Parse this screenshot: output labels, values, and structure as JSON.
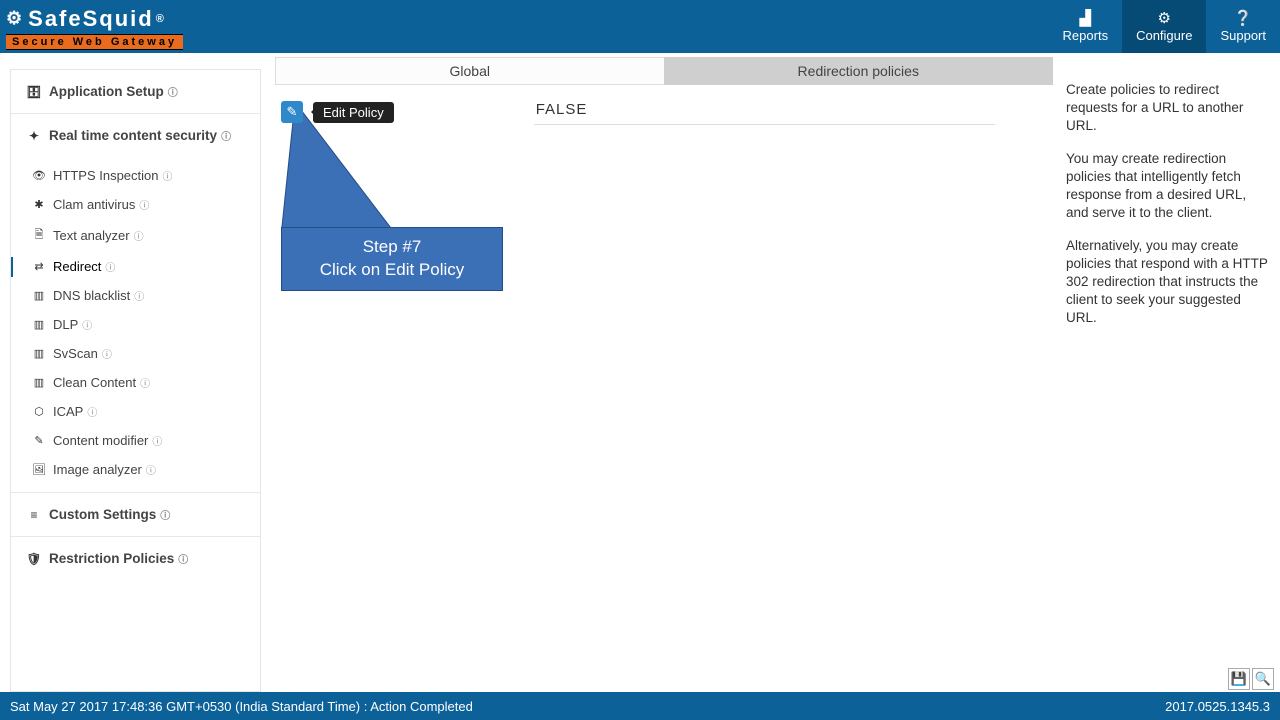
{
  "brand": {
    "name": "SafeSquid",
    "reg": "®",
    "tagline": "Secure Web Gateway"
  },
  "nav": {
    "reports": "Reports",
    "configure": "Configure",
    "support": "Support"
  },
  "sidebar": {
    "app_setup": "Application Setup",
    "realtime": "Real time content security",
    "items": [
      {
        "label": "HTTPS Inspection"
      },
      {
        "label": "Clam antivirus"
      },
      {
        "label": "Text analyzer"
      },
      {
        "label": "Redirect"
      },
      {
        "label": "DNS blacklist"
      },
      {
        "label": "DLP"
      },
      {
        "label": "SvScan"
      },
      {
        "label": "Clean Content"
      },
      {
        "label": "ICAP"
      },
      {
        "label": "Content modifier"
      },
      {
        "label": "Image analyzer"
      }
    ],
    "custom": "Custom Settings",
    "restrict": "Restriction Policies"
  },
  "tabs": {
    "global": "Global",
    "redir": "Redirection policies"
  },
  "edit": {
    "tooltip": "Edit Policy",
    "value": "FALSE"
  },
  "callout": {
    "line1": "Step #7",
    "line2": "Click on Edit Policy"
  },
  "help": {
    "p1": "Create policies to redirect requests for a URL to another URL.",
    "p2": "You may create redirection policies that intelligently fetch response from a desired URL, and serve it to the client.",
    "p3": "Alternatively, you may create policies that respond with a HTTP 302 redirection that instructs the client to seek your suggested URL."
  },
  "footer": {
    "status": "Sat May 27 2017 17:48:36 GMT+0530 (India Standard Time) : Action Completed",
    "version": "2017.0525.1345.3"
  }
}
